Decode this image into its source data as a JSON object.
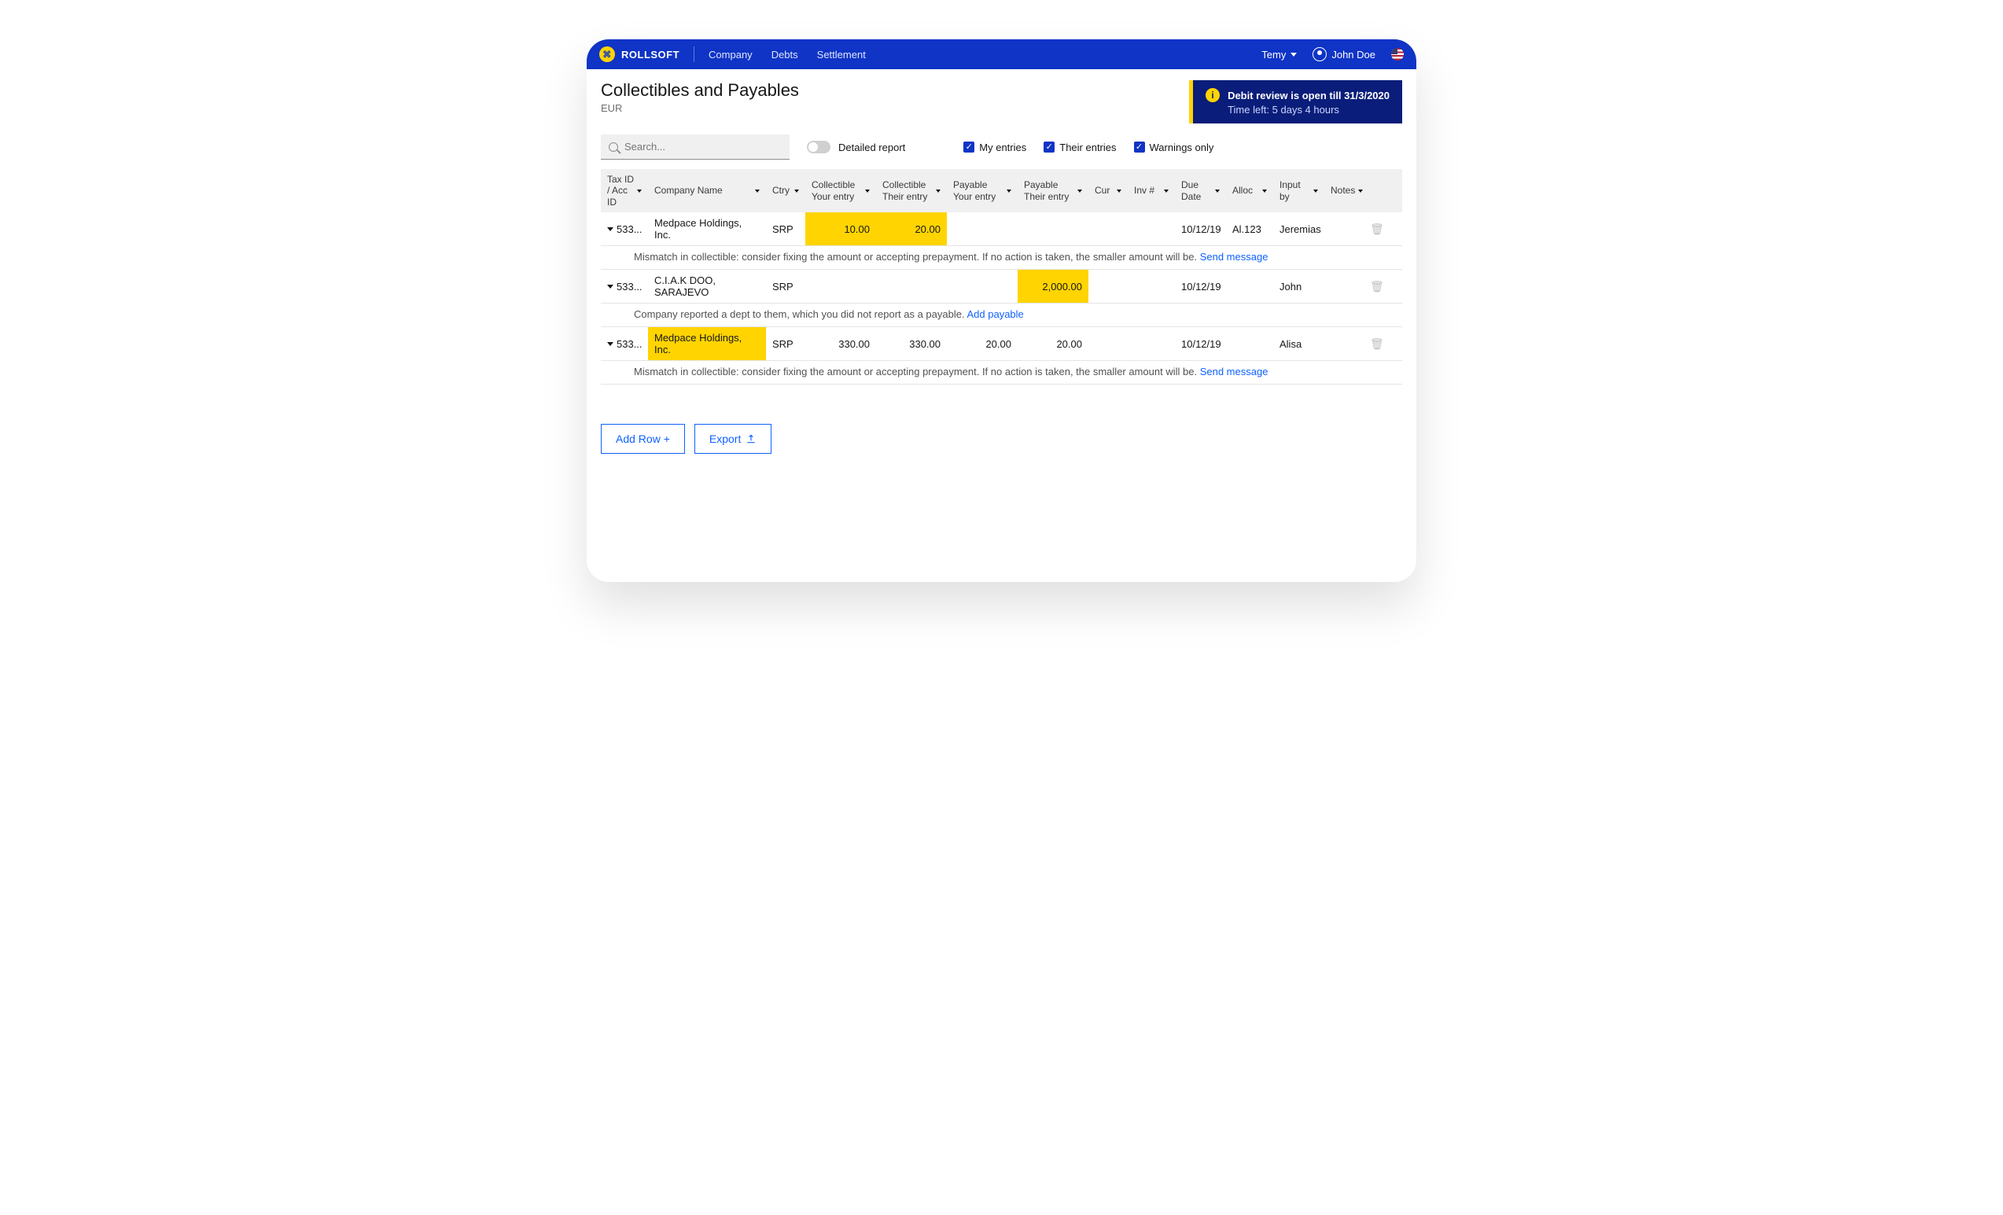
{
  "brand": "ROLLSOFT",
  "nav": {
    "company": "Company",
    "debts": "Debts",
    "settlement": "Settlement"
  },
  "account": {
    "org": "Temy",
    "user": "John Doe"
  },
  "page": {
    "title": "Collectibles and Payables",
    "currency": "EUR"
  },
  "alert": {
    "line1": "Debit review is open till 31/3/2020",
    "line2": "Time left: 5 days 4 hours"
  },
  "search": {
    "placeholder": "Search..."
  },
  "filters": {
    "detailed": "Detailed report",
    "my": "My entries",
    "their": "Their entries",
    "warn": "Warnings only"
  },
  "columns": {
    "taxid": "Tax ID / Acc ID",
    "company": "Company Name",
    "ctry": "Ctry",
    "collYour": "Collectible Your entry",
    "collTheir": "Collectible Their entry",
    "payYour": "Payable Your entry",
    "payTheir": "Payable Their entry",
    "cur": "Cur",
    "inv": "Inv #",
    "due": "Due Date",
    "alloc": "Alloc",
    "inputBy": "Input by",
    "notes": "Notes"
  },
  "rows": [
    {
      "taxid": "533...",
      "company": "Medpace Holdings, Inc.",
      "ctry": "SRP",
      "collYour": "10.00",
      "collTheir": "20.00",
      "payYour": "",
      "payTheir": "",
      "cur": "",
      "inv": "",
      "due": "10/12/19",
      "alloc": "Al.123",
      "inputBy": "Jeremias",
      "warnText": "Mismatch in collectible: consider fixing the amount or accepting prepayment. If no action is taken, the smaller amount will be.",
      "warnLink": "Send message",
      "hl": {
        "collYour": true,
        "collTheir": true
      }
    },
    {
      "taxid": "533...",
      "company": "C.I.A.K DOO, SARAJEVO",
      "ctry": "SRP",
      "collYour": "",
      "collTheir": "",
      "payYour": "",
      "payTheir": "2,000.00",
      "cur": "",
      "inv": "",
      "due": "10/12/19",
      "alloc": "",
      "inputBy": "John",
      "warnText": "Company reported a dept to them, which you did not report as a payable.",
      "warnLink": "Add payable",
      "hl": {
        "payTheir": true
      }
    },
    {
      "taxid": "533...",
      "company": "Medpace Holdings, Inc.",
      "ctry": "SRP",
      "collYour": "330.00",
      "collTheir": "330.00",
      "payYour": "20.00",
      "payTheir": "20.00",
      "cur": "",
      "inv": "",
      "due": "10/12/19",
      "alloc": "",
      "inputBy": "Alisa",
      "warnText": "Mismatch in collectible: consider fixing the amount or accepting prepayment. If no action is taken, the smaller amount will be.",
      "warnLink": "Send message",
      "hl": {
        "company": true
      }
    }
  ],
  "buttons": {
    "addRow": "Add Row +",
    "export": "Export"
  }
}
